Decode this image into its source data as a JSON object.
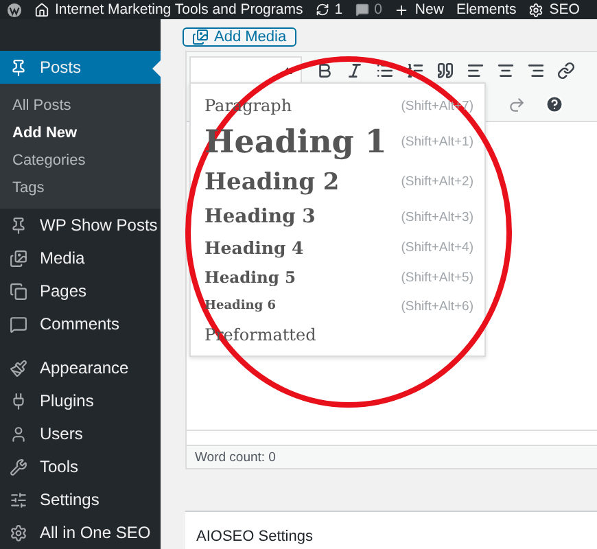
{
  "admin_bar": {
    "site_title": "Internet Marketing Tools and Programs",
    "updates_count": "1",
    "comments_count": "0",
    "new_label": "New",
    "items": [
      "Elements",
      "SEO"
    ]
  },
  "sidebar": {
    "items": [
      {
        "label": "Posts",
        "selected": true,
        "children": [
          {
            "label": "All Posts",
            "selected": false
          },
          {
            "label": "Add New",
            "selected": true
          },
          {
            "label": "Categories",
            "selected": false
          },
          {
            "label": "Tags",
            "selected": false
          }
        ]
      },
      {
        "label": "WP Show Posts",
        "selected": false
      },
      {
        "label": "Media",
        "selected": false
      },
      {
        "label": "Pages",
        "selected": false
      },
      {
        "label": "Comments",
        "selected": false
      },
      {
        "label": "Appearance",
        "selected": false
      },
      {
        "label": "Plugins",
        "selected": false
      },
      {
        "label": "Users",
        "selected": false
      },
      {
        "label": "Tools",
        "selected": false
      },
      {
        "label": "Settings",
        "selected": false
      },
      {
        "label": "All in One SEO",
        "selected": false
      }
    ]
  },
  "editor": {
    "add_media_label": "Add Media",
    "format_menu": {
      "items": [
        {
          "kind": "p",
          "label": "Paragraph",
          "shortcut": "(Shift+Alt+7)"
        },
        {
          "kind": "h1",
          "label": "Heading 1",
          "shortcut": "(Shift+Alt+1)"
        },
        {
          "kind": "h2",
          "label": "Heading 2",
          "shortcut": "(Shift+Alt+2)"
        },
        {
          "kind": "h3",
          "label": "Heading 3",
          "shortcut": "(Shift+Alt+3)"
        },
        {
          "kind": "h4",
          "label": "Heading 4",
          "shortcut": "(Shift+Alt+4)"
        },
        {
          "kind": "h5",
          "label": "Heading 5",
          "shortcut": "(Shift+Alt+5)"
        },
        {
          "kind": "h6",
          "label": "Heading 6",
          "shortcut": "(Shift+Alt+6)"
        },
        {
          "kind": "pre",
          "label": "Preformatted"
        }
      ]
    },
    "word_count": "Word count: 0"
  },
  "panel": {
    "title": "AIOSEO Settings"
  }
}
